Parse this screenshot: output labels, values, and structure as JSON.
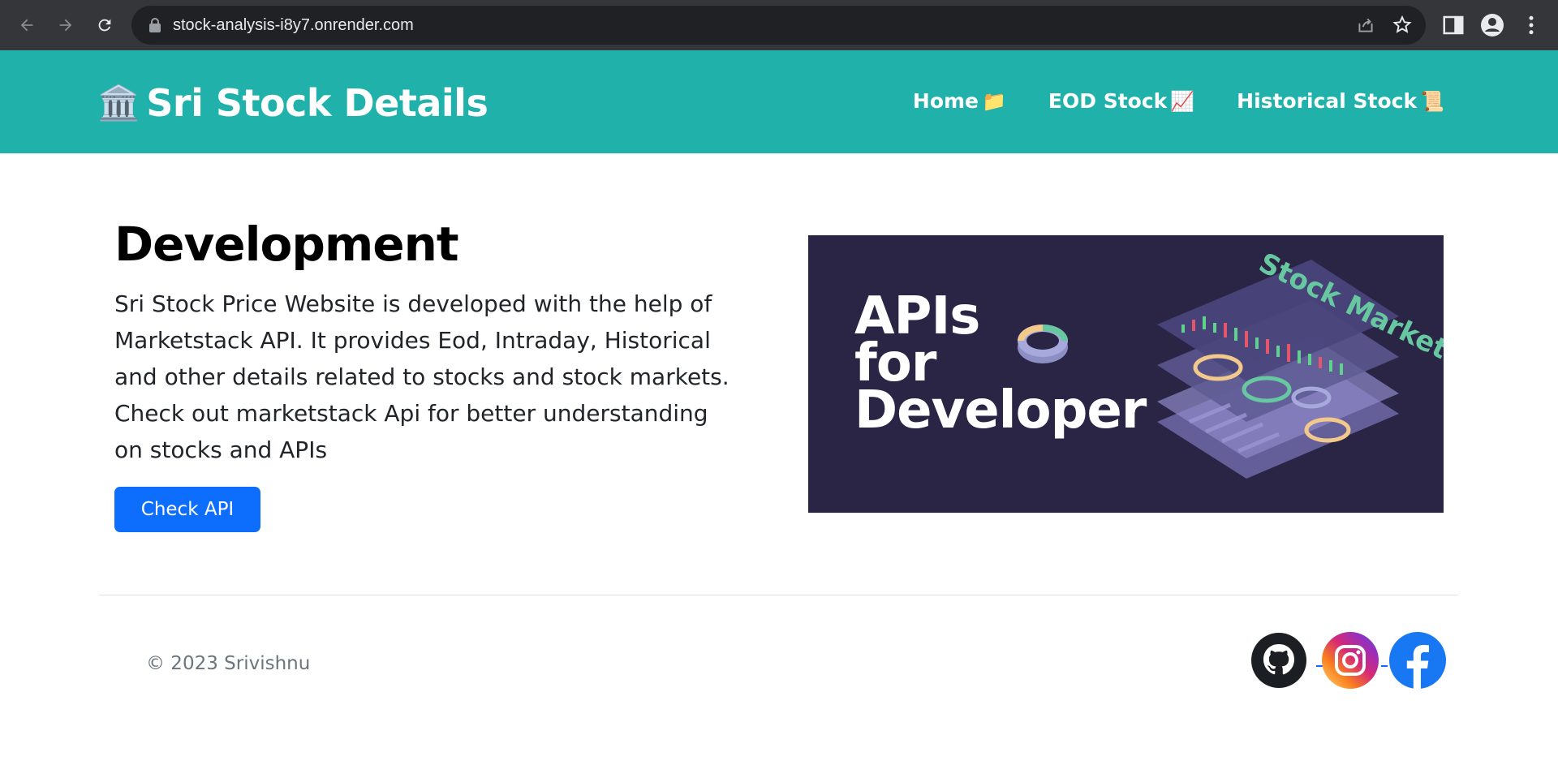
{
  "browser": {
    "url": "stock-analysis-i8y7.onrender.com"
  },
  "site": {
    "brand_emoji": "🏛️",
    "brand": "Sri Stock Details",
    "nav": [
      {
        "label": "Home",
        "emoji": "📁"
      },
      {
        "label": "EOD Stock",
        "emoji": "📈"
      },
      {
        "label": "Historical Stock",
        "emoji": "📜"
      }
    ],
    "header_color": "#20b2aa"
  },
  "main": {
    "title": "Development",
    "description": "Sri Stock Price Website is developed with the help of Marketstack API. It provides Eod, Intraday, Historical and other details related to stocks and stock markets. Check out marketstack Api for better understanding on stocks and APIs",
    "button_label": "Check API",
    "button_color": "#0d6efd"
  },
  "banner": {
    "line1": "APIs",
    "line2": "for",
    "line3": "Developer",
    "tag": "Stock Market"
  },
  "footer": {
    "copyright": "© 2023 Srivishnu",
    "social_icons": [
      "github-icon",
      "instagram-icon",
      "facebook-icon"
    ]
  }
}
